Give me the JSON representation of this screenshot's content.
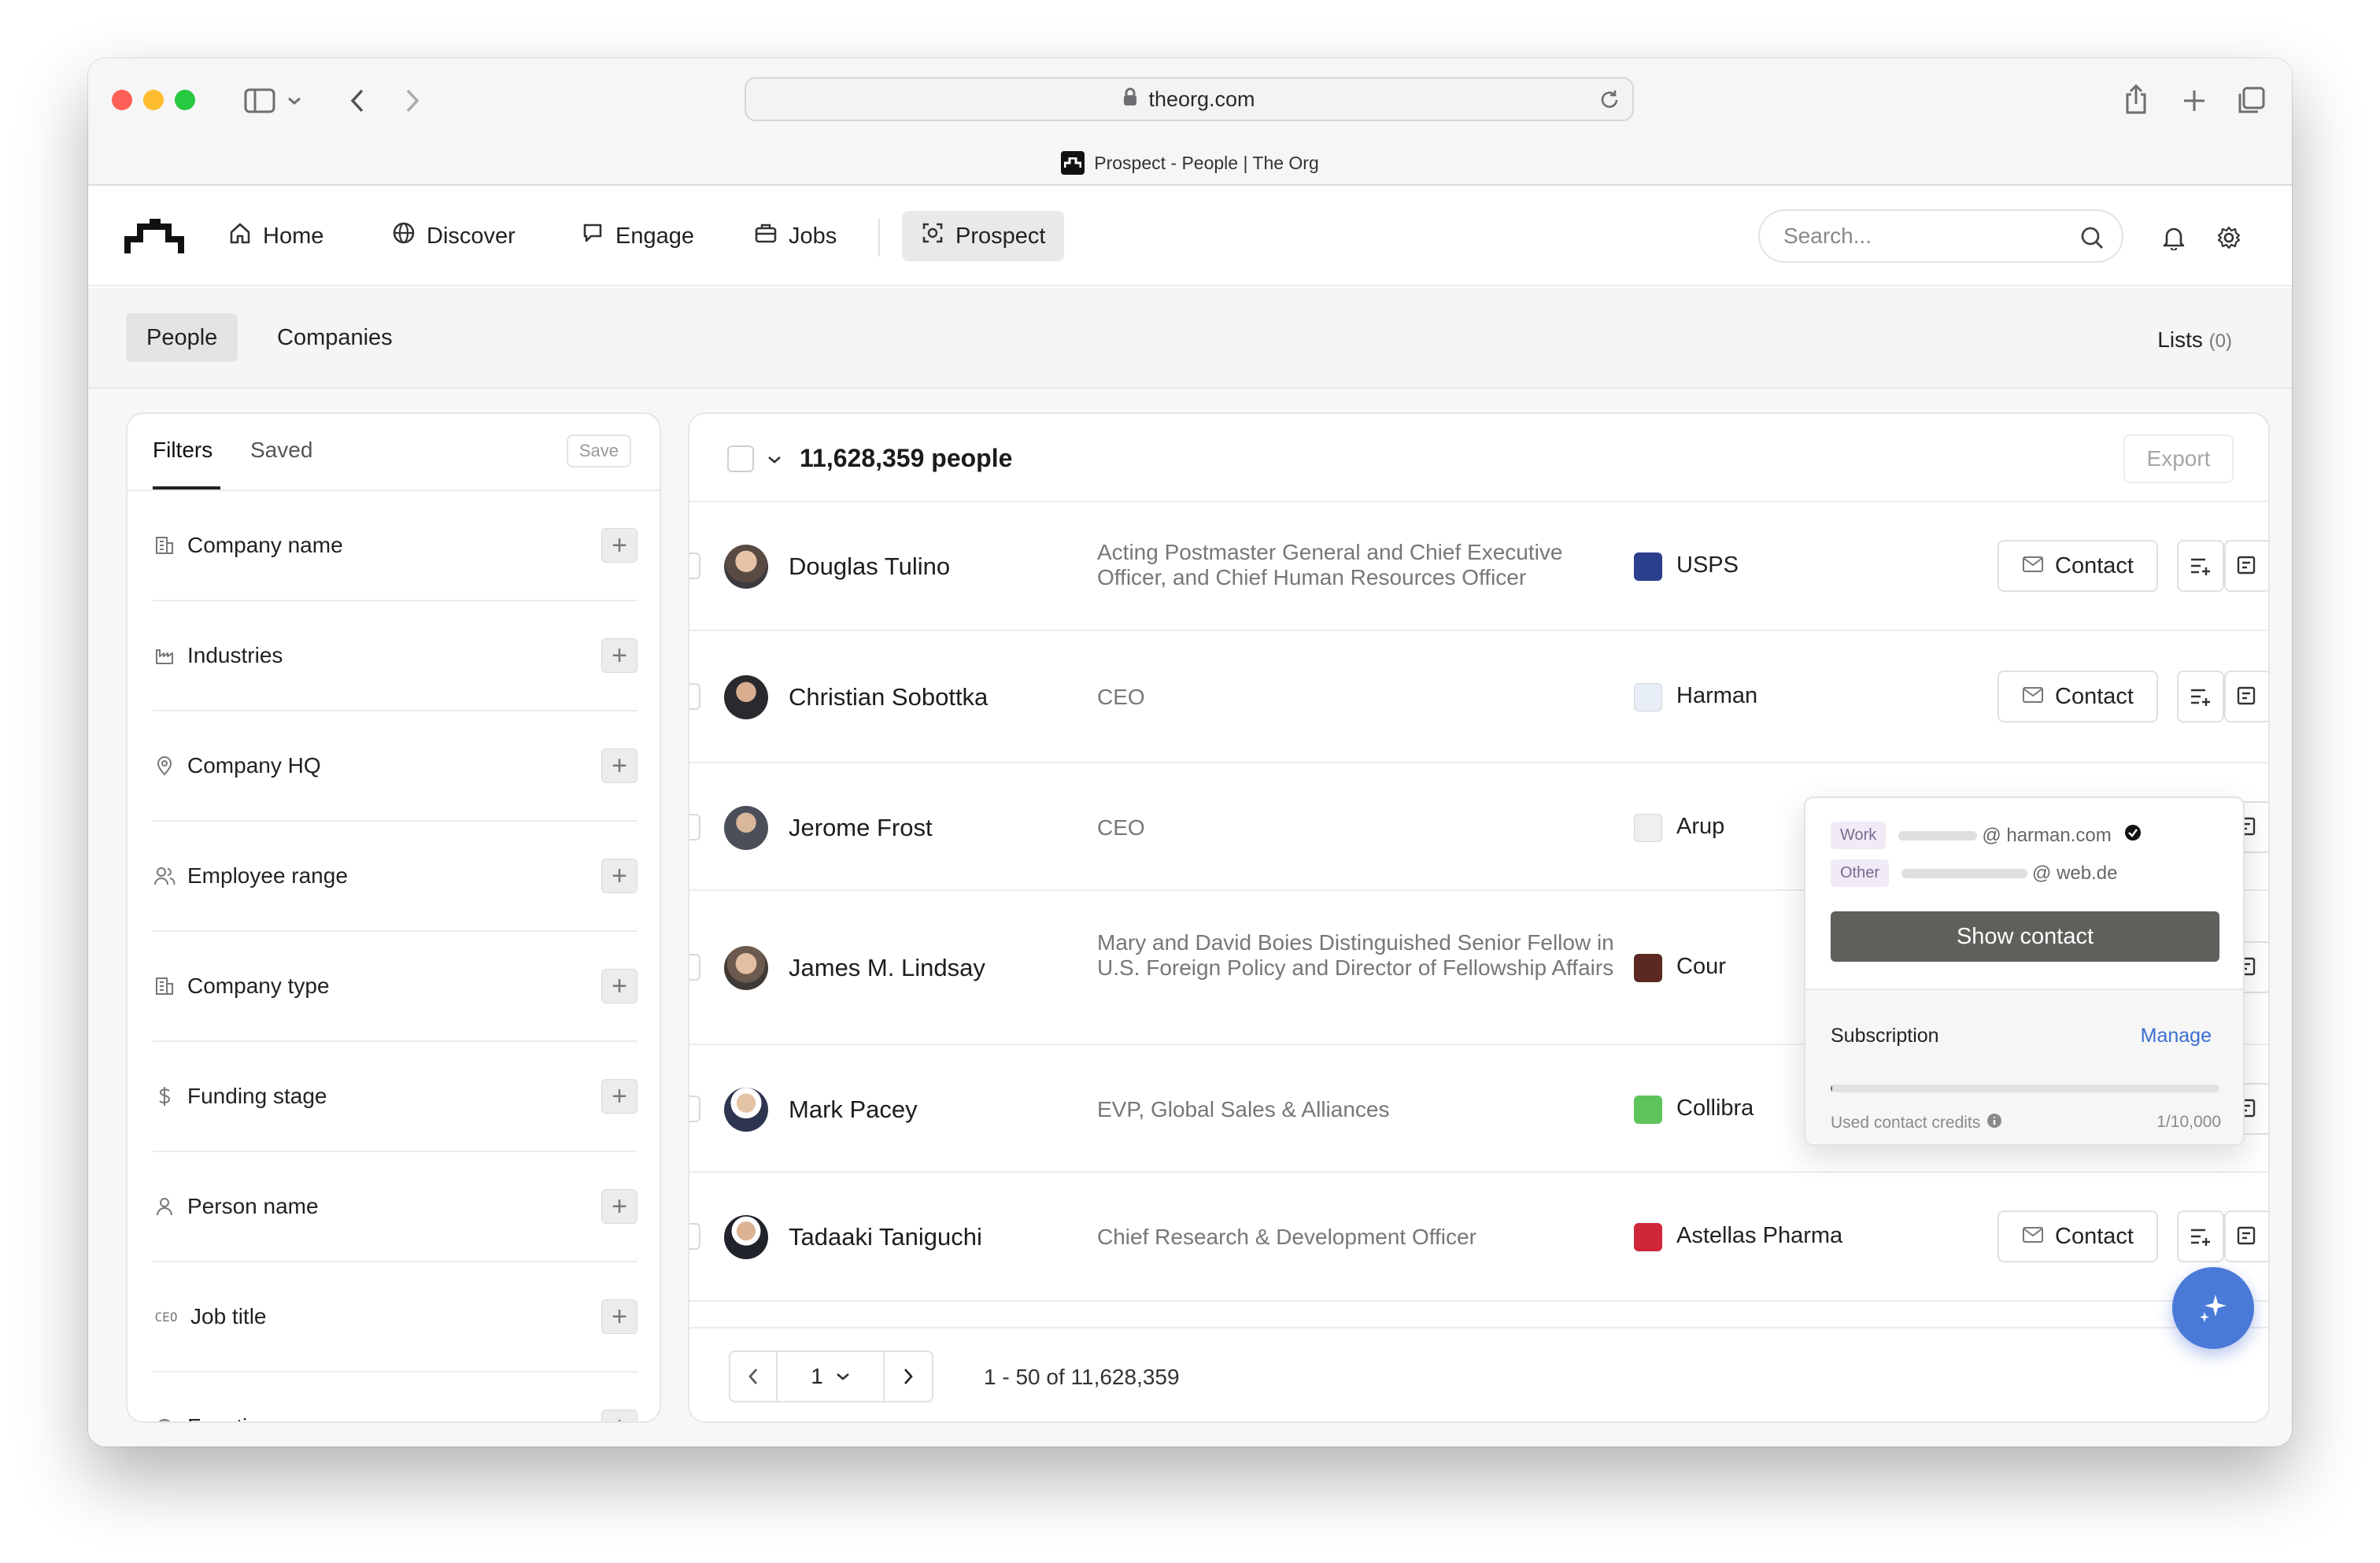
{
  "browser": {
    "url": "theorg.com",
    "tab_title": "Prospect - People | The Org"
  },
  "nav": {
    "items": [
      {
        "label": "Home",
        "icon": "home-icon"
      },
      {
        "label": "Discover",
        "icon": "globe-icon"
      },
      {
        "label": "Engage",
        "icon": "engage-icon"
      },
      {
        "label": "Jobs",
        "icon": "briefcase-icon"
      },
      {
        "label": "Prospect",
        "icon": "prospect-icon",
        "active": true
      }
    ],
    "search_placeholder": "Search..."
  },
  "subtabs": {
    "people": "People",
    "companies": "Companies",
    "lists_label": "Lists",
    "lists_count": "(0)"
  },
  "filters": {
    "tab_filters": "Filters",
    "tab_saved": "Saved",
    "save_label": "Save",
    "items": [
      {
        "label": "Company name",
        "icon": "building-icon"
      },
      {
        "label": "Industries",
        "icon": "factory-icon"
      },
      {
        "label": "Company HQ",
        "icon": "location-pin-icon"
      },
      {
        "label": "Employee range",
        "icon": "people-icon"
      },
      {
        "label": "Company type",
        "icon": "building-icon"
      },
      {
        "label": "Funding stage",
        "icon": "dollar-icon"
      },
      {
        "label": "Person name",
        "icon": "person-icon"
      },
      {
        "label": "Job title",
        "icon": "ceo-tag-icon",
        "icon_text": "CEO"
      },
      {
        "label": "Function",
        "icon": "function-icon"
      }
    ]
  },
  "results": {
    "count_label": "11,628,359 people",
    "export_label": "Export",
    "contact_label": "Contact",
    "rows": [
      {
        "name": "Douglas Tulino",
        "title": "Acting Postmaster General and Chief Executive Officer, and Chief Human Resources Officer",
        "company": "USPS",
        "logo_color": "#2b3f8f"
      },
      {
        "name": "Christian Sobottka",
        "title": "CEO",
        "company": "Harman",
        "logo_color": "#e8eef6"
      },
      {
        "name": "Jerome Frost",
        "title": "CEO",
        "company": "Arup",
        "logo_color": "#efefef"
      },
      {
        "name": "James M. Lindsay",
        "title": "Mary and David Boies Distinguished Senior Fellow in U.S. Foreign Policy and Director of Fellowship Affairs",
        "company": "Cour",
        "logo_color": "#5a2a22"
      },
      {
        "name": "Mark Pacey",
        "title": "EVP, Global Sales & Alliances",
        "company": "Collibra",
        "logo_color": "#5cc45a"
      },
      {
        "name": "Tadaaki Taniguchi",
        "title": "Chief Research & Development Officer",
        "company": "Astellas Pharma",
        "logo_color": "#d0263a"
      }
    ],
    "pager_page": "1",
    "range_text": "1 - 50 of 11,628,359"
  },
  "popover": {
    "work_tag": "Work",
    "work_domain": "@ harman.com",
    "other_tag": "Other",
    "other_domain": "@ web.de",
    "show_contact": "Show contact",
    "subscription_label": "Subscription",
    "manage_label": "Manage",
    "credits_label": "Used contact credits",
    "credits_value": "1/10,000",
    "credits_used_fraction": 0.0001
  },
  "colors": {
    "accent_blue": "#3a6fd0",
    "fab_blue": "#4a7ad8",
    "show_contact_bg": "#5f5f5b"
  }
}
